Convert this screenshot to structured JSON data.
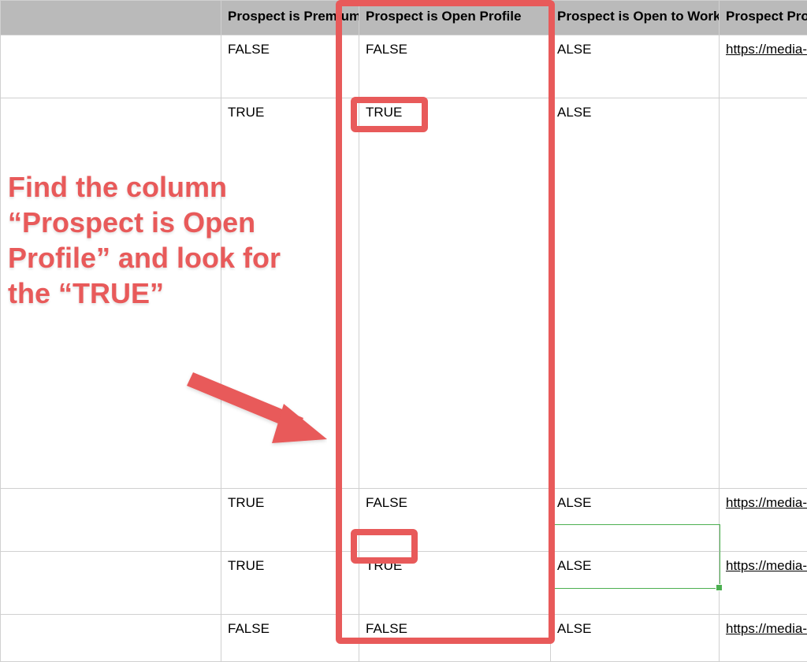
{
  "headers": {
    "col0": "",
    "col1": "Prospect is Premium",
    "col2": "Prospect is Open Profile",
    "col3": "Prospect is Open to Work",
    "col4": "Prospect Profile"
  },
  "rows": [
    {
      "premium": "FALSE",
      "open_profile": "FALSE",
      "open_to_work": "ALSE",
      "profile": "https://media-exp"
    },
    {
      "premium": "TRUE",
      "open_profile": "TRUE",
      "open_to_work": "ALSE",
      "profile": ""
    },
    {
      "premium": "TRUE",
      "open_profile": "FALSE",
      "open_to_work": "ALSE",
      "profile": "https://media-exp"
    },
    {
      "premium": "TRUE",
      "open_profile": "TRUE",
      "open_to_work": "ALSE",
      "profile": "https://media-exp"
    },
    {
      "premium": "FALSE",
      "open_profile": "FALSE",
      "open_to_work": "ALSE",
      "profile": "https://media-exp"
    }
  ],
  "annotation": {
    "text": "Find the column “Prospect is Open Profile” and look for the “TRUE”"
  },
  "colors": {
    "annotation": "#e85a5a"
  }
}
